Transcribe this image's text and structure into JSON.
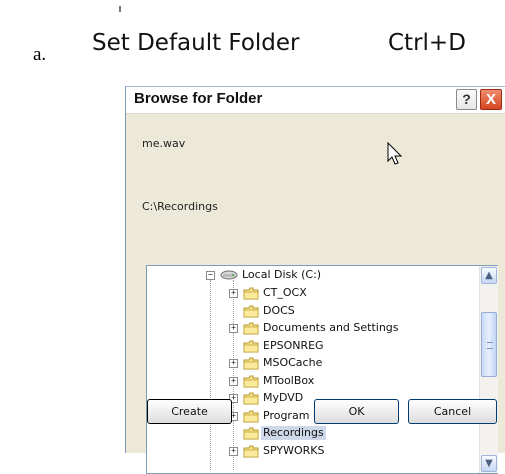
{
  "doc": {
    "letter": "a."
  },
  "menu": {
    "item_label": "Set Default Folder",
    "shortcut": "Ctrl+D"
  },
  "dialog": {
    "title": "Browse for Folder",
    "help_label": "?",
    "close_label": "X",
    "file_name": "me.wav",
    "path": "C:\\Recordings",
    "tree": {
      "root": "Local Disk (C:)",
      "items": [
        {
          "label": "CT_OCX",
          "expandable": true,
          "selected": false
        },
        {
          "label": "DOCS",
          "expandable": false,
          "selected": false
        },
        {
          "label": "Documents and Settings",
          "expandable": true,
          "selected": false
        },
        {
          "label": "EPSONREG",
          "expandable": false,
          "selected": false
        },
        {
          "label": "MSOCache",
          "expandable": true,
          "selected": false
        },
        {
          "label": "MToolBox",
          "expandable": true,
          "selected": false
        },
        {
          "label": "MyDVD",
          "expandable": true,
          "selected": false
        },
        {
          "label": "Program Files",
          "expandable": true,
          "selected": false
        },
        {
          "label": "Recordings",
          "expandable": false,
          "selected": true
        },
        {
          "label": "SPYWORKS",
          "expandable": true,
          "selected": false
        }
      ]
    },
    "buttons": {
      "create": "Create",
      "ok": "OK",
      "cancel": "Cancel"
    }
  },
  "colors": {
    "dialog_bg": "#ece9d8",
    "selection_bg": "#cfd8e8",
    "close_red": "#d6451f"
  },
  "icons": {
    "folder": "folder-icon",
    "drive": "drive-icon",
    "cursor": "mouse-cursor-icon"
  }
}
